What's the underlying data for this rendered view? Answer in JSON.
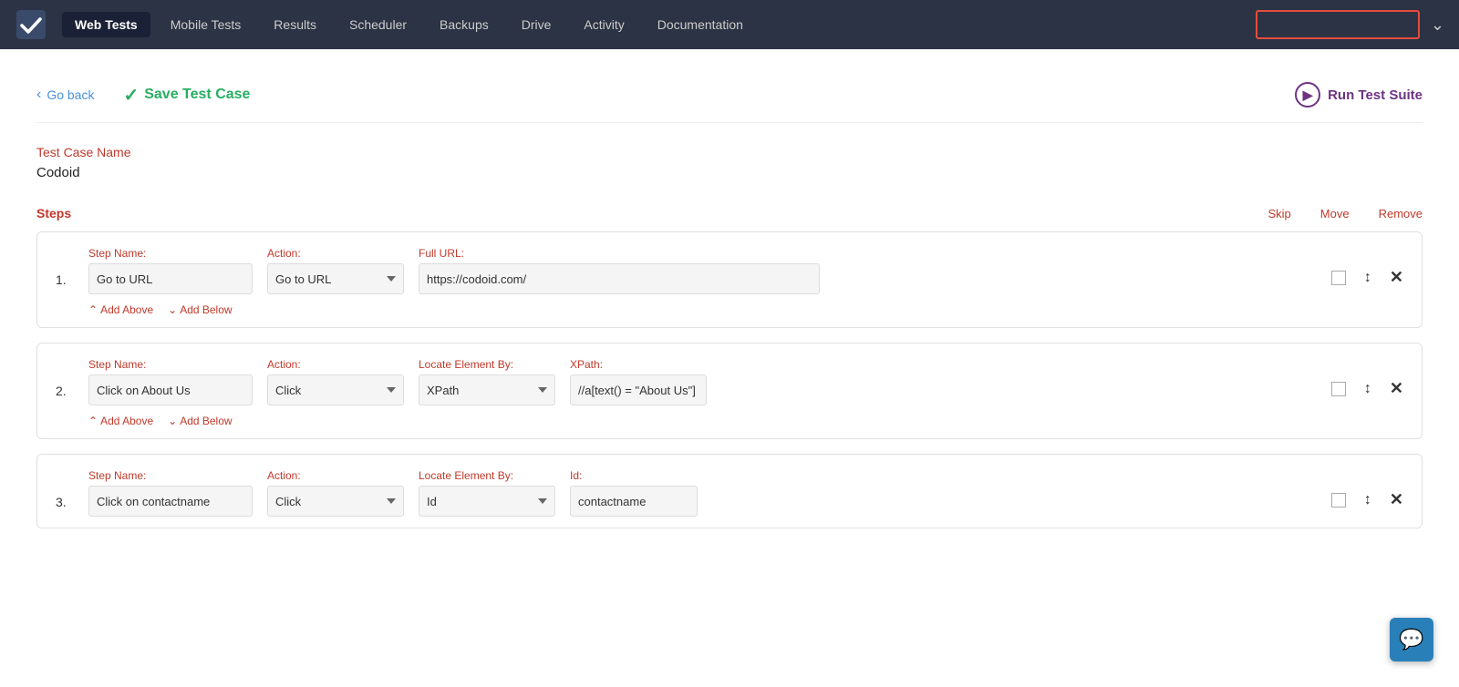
{
  "navbar": {
    "logo_label": "✓",
    "items": [
      {
        "label": "Web Tests",
        "active": true
      },
      {
        "label": "Mobile Tests",
        "active": false
      },
      {
        "label": "Results",
        "active": false
      },
      {
        "label": "Scheduler",
        "active": false
      },
      {
        "label": "Backups",
        "active": false
      },
      {
        "label": "Drive",
        "active": false
      },
      {
        "label": "Activity",
        "active": false
      },
      {
        "label": "Documentation",
        "active": false
      }
    ],
    "search_placeholder": ""
  },
  "toolbar": {
    "go_back_label": "Go back",
    "save_test_label": "Save Test Case",
    "run_test_label": "Run Test Suite"
  },
  "test_case": {
    "label": "Test Case Name",
    "value": "Codoid"
  },
  "steps_section": {
    "label": "Steps",
    "skip_label": "Skip",
    "move_label": "Move",
    "remove_label": "Remove"
  },
  "steps": [
    {
      "number": "1.",
      "step_name_label": "Step Name:",
      "step_name_value": "Go to URL",
      "action_label": "Action:",
      "action_value": "Go to URL",
      "extra_label": "Full URL:",
      "extra_value": "https://codoid.com/",
      "extra_type": "url",
      "locate_label": "",
      "locate_value": "",
      "add_above": "Add Above",
      "add_below": "Add Below"
    },
    {
      "number": "2.",
      "step_name_label": "Step Name:",
      "step_name_value": "Click on About Us",
      "action_label": "Action:",
      "action_value": "Click",
      "locate_label": "Locate Element By:",
      "locate_value": "XPath",
      "extra_label": "XPath:",
      "extra_value": "//a[text() = \"About Us\"]",
      "extra_type": "xpath",
      "add_above": "Add Above",
      "add_below": "Add Below"
    },
    {
      "number": "3.",
      "step_name_label": "Step Name:",
      "step_name_value": "Click on contactname",
      "action_label": "Action:",
      "action_value": "Click",
      "locate_label": "Locate Element By:",
      "locate_value": "Id",
      "extra_label": "Id:",
      "extra_value": "contactname",
      "extra_type": "id",
      "add_above": "",
      "add_below": ""
    }
  ],
  "chat_btn": {
    "icon": "💬"
  }
}
